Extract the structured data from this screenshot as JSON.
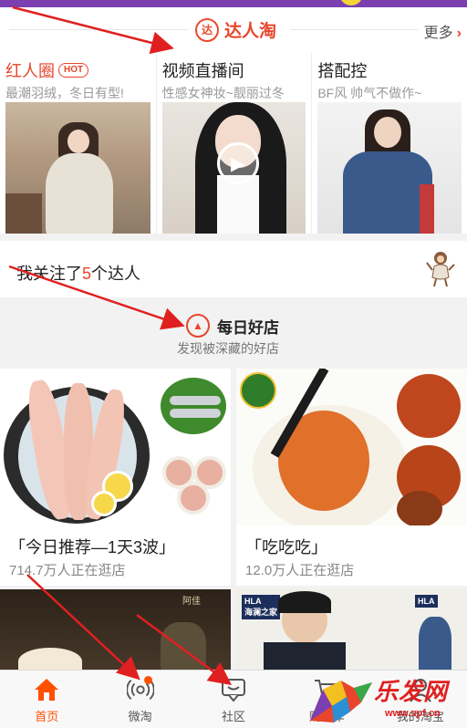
{
  "talent_section": {
    "title": "达人淘",
    "logo_letter": "达",
    "more_label": "更多",
    "more_arrow": "›"
  },
  "talent_cards": [
    {
      "title": "红人圈",
      "badge": "HOT",
      "subtitle": "最潮羽绒，冬日有型!"
    },
    {
      "title": "视频直播间",
      "subtitle": "性感女神妆~靓丽过冬"
    },
    {
      "title": "搭配控",
      "subtitle": "BF风 帅气不做作~"
    }
  ],
  "follow": {
    "prefix": "我关注了",
    "count": "5",
    "suffix": "个达人"
  },
  "daily_shop": {
    "title": "每日好店",
    "subtitle": "发现被深藏的好店"
  },
  "shops": [
    {
      "name": "「今日推荐—1天3波」",
      "visitors": "714.7万人正在逛店"
    },
    {
      "name": "「吃吃吃」",
      "visitors": "12.0万人正在逛店"
    }
  ],
  "row3": {
    "brand_a": "阿佳",
    "brand_b": "HLA",
    "brand_b_sub": "海澜之家"
  },
  "tabbar": [
    {
      "label": "首页",
      "icon": "home-icon",
      "active": true
    },
    {
      "label": "微淘",
      "icon": "broadcast-icon",
      "active": false
    },
    {
      "label": "社区",
      "icon": "chat-icon",
      "active": false
    },
    {
      "label": "购物车",
      "icon": "cart-icon",
      "active": false
    },
    {
      "label": "我的淘宝",
      "icon": "user-icon",
      "active": false
    }
  ],
  "watermark": {
    "text": "乐发网",
    "url": "www.spf.cn"
  },
  "colors": {
    "accent": "#e8452a",
    "tab_active": "#ff5000",
    "annotation_arrow": "#e02020"
  }
}
